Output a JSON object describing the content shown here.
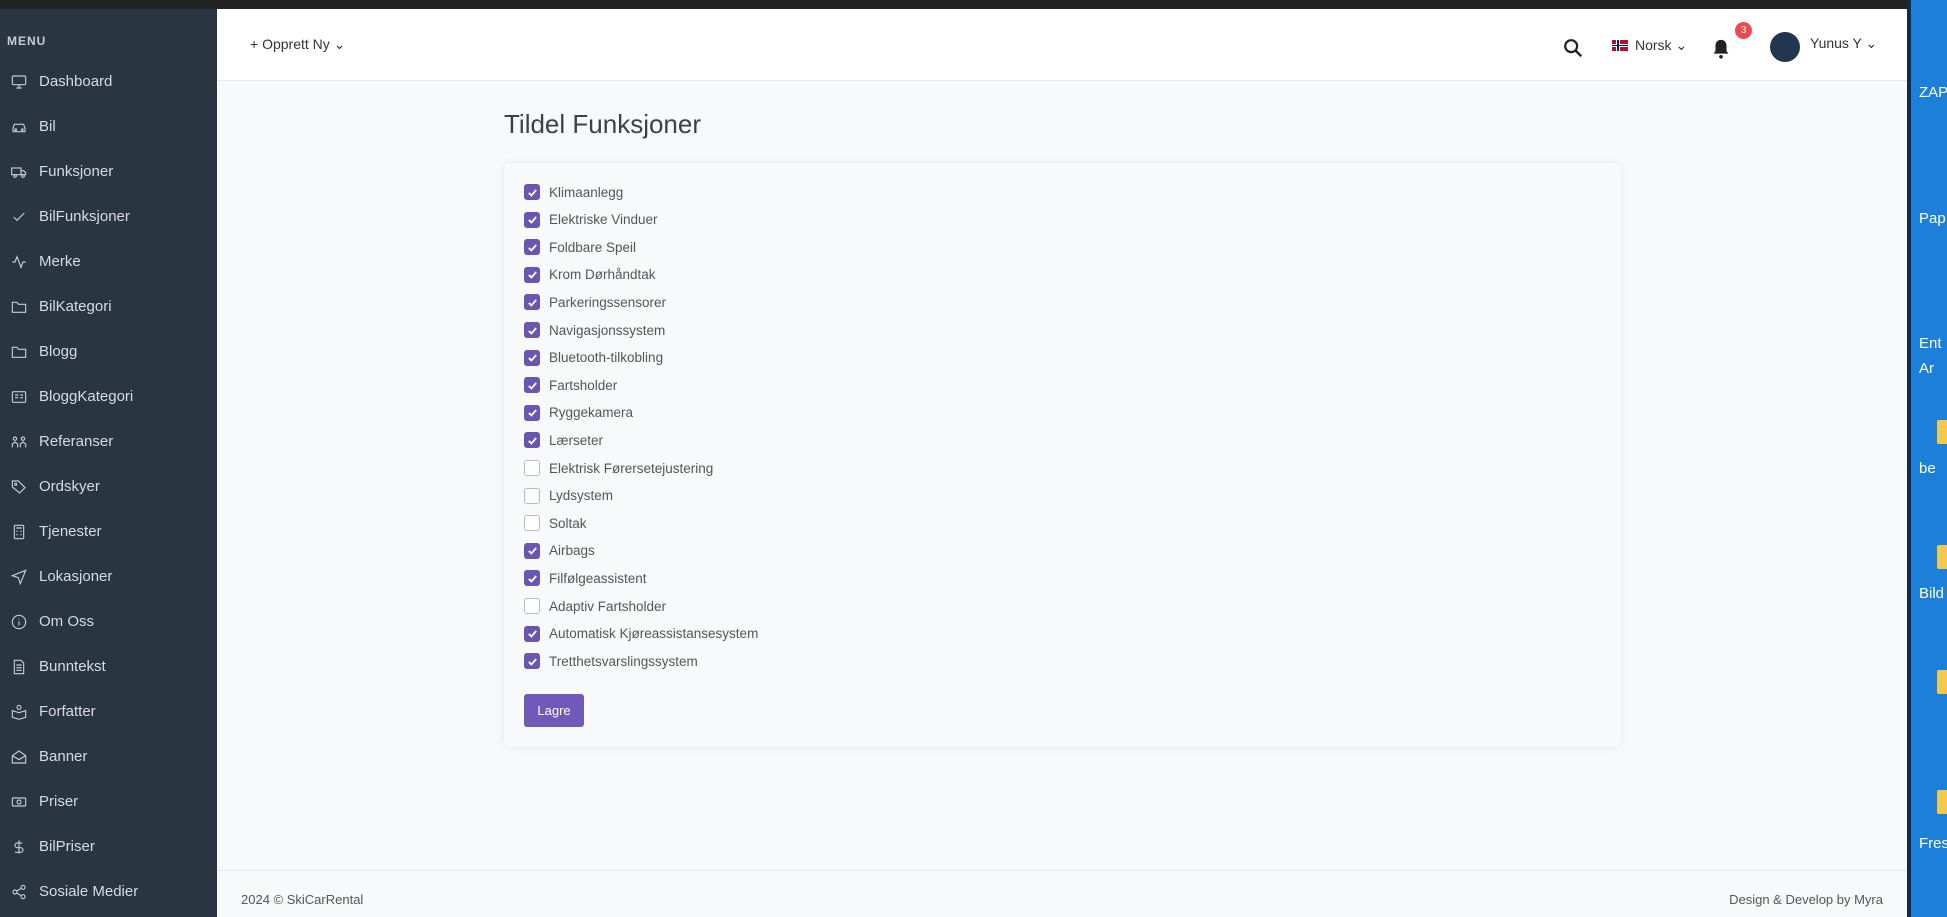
{
  "sidebar": {
    "menu_title": "MENU",
    "items": [
      {
        "label": "Dashboard",
        "icon": "monitor-icon"
      },
      {
        "label": "Bil",
        "icon": "car-icon"
      },
      {
        "label": "Funksjoner",
        "icon": "truck-icon"
      },
      {
        "label": "BilFunksjoner",
        "icon": "check-icon"
      },
      {
        "label": "Merke",
        "icon": "activity-icon"
      },
      {
        "label": "BilKategori",
        "icon": "folder-icon"
      },
      {
        "label": "Blogg",
        "icon": "folder-icon"
      },
      {
        "label": "BloggKategori",
        "icon": "id-card-icon"
      },
      {
        "label": "Referanser",
        "icon": "people-icon"
      },
      {
        "label": "Ordskyer",
        "icon": "tags-icon"
      },
      {
        "label": "Tjenester",
        "icon": "calculator-icon"
      },
      {
        "label": "Lokasjoner",
        "icon": "location-arrow-icon"
      },
      {
        "label": "Om Oss",
        "icon": "info-icon"
      },
      {
        "label": "Bunntekst",
        "icon": "document-icon"
      },
      {
        "label": "Forfatter",
        "icon": "reader-icon"
      },
      {
        "label": "Banner",
        "icon": "envelope-open-icon"
      },
      {
        "label": "Priser",
        "icon": "money-icon"
      },
      {
        "label": "BilPriser",
        "icon": "dollar-icon"
      },
      {
        "label": "Sosiale Medier",
        "icon": "share-icon"
      }
    ]
  },
  "header": {
    "create_label": "+ Opprett Ny ⌄",
    "language": "Norsk ⌄",
    "notification_count": "3",
    "user_name": "Yunus Y ⌄"
  },
  "main": {
    "title": "Tildel Funksjoner",
    "features": [
      {
        "label": "Klimaanlegg",
        "checked": true
      },
      {
        "label": "Elektriske Vinduer",
        "checked": true
      },
      {
        "label": "Foldbare Speil",
        "checked": true
      },
      {
        "label": "Krom Dørhåndtak",
        "checked": true
      },
      {
        "label": "Parkeringssensorer",
        "checked": true
      },
      {
        "label": "Navigasjonssystem",
        "checked": true
      },
      {
        "label": "Bluetooth-tilkobling",
        "checked": true
      },
      {
        "label": "Fartsholder",
        "checked": true
      },
      {
        "label": "Ryggekamera",
        "checked": true
      },
      {
        "label": "Lærseter",
        "checked": true
      },
      {
        "label": "Elektrisk Førersetejustering",
        "checked": false
      },
      {
        "label": "Lydsystem",
        "checked": false
      },
      {
        "label": "Soltak",
        "checked": false
      },
      {
        "label": "Airbags",
        "checked": true
      },
      {
        "label": "Filfølgeassistent",
        "checked": true
      },
      {
        "label": "Adaptiv Fartsholder",
        "checked": false
      },
      {
        "label": "Automatisk Kjøreassistansesystem",
        "checked": true
      },
      {
        "label": "Tretthetsvarslingssystem",
        "checked": true
      }
    ],
    "save_label": "Lagre"
  },
  "footer": {
    "left": "2024 © SkiCarRental",
    "right": "Design & Develop by Myra"
  },
  "desktop_icons": [
    {
      "label": "ZAP"
    },
    {
      "label": "Pap"
    },
    {
      "label": "Ent"
    },
    {
      "label": "Ar"
    },
    {
      "label": "be"
    },
    {
      "label": "Bild"
    },
    {
      "label": "Fres"
    }
  ],
  "colors": {
    "sidebar_bg": "#2a3542",
    "accent": "#6a55b0",
    "badge": "#f0484e"
  }
}
